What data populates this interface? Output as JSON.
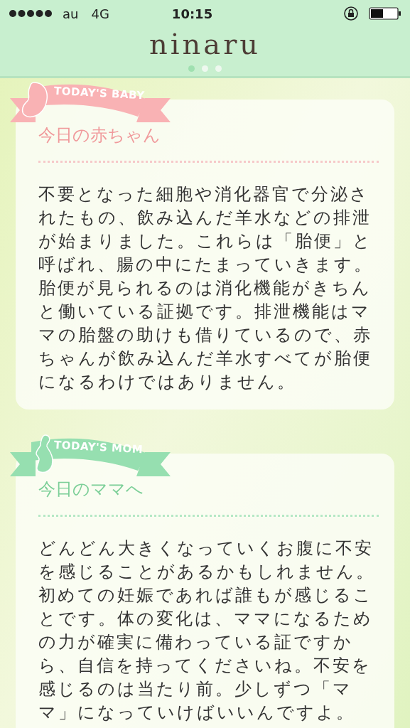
{
  "status_bar": {
    "carrier": "au",
    "network": "4G",
    "time": "10:15"
  },
  "header": {
    "logo": "ninaru",
    "pages": [
      {
        "selected": true
      },
      {
        "selected": false
      },
      {
        "selected": false
      }
    ]
  },
  "cards": [
    {
      "kind": "baby",
      "ribbon": "TODAY'S BABY",
      "title": "今日の赤ちゃん",
      "body_lines": [
        "不要となった細胞や消化器官で分泌さ",
        "れたもの、飲み込んだ羊水などの排泄",
        "が始まりました。これらは「胎便」と",
        "呼ばれ、腸の中にたまっていきます。",
        "胎便が見られるのは消化機能がきちん",
        "と働いている証拠です。排泄機能はマ",
        "マの胎盤の助けも借りているので、赤",
        "ちゃんが飲み込んだ羊水すべてが胎便",
        "になるわけではありません。"
      ]
    },
    {
      "kind": "mom",
      "ribbon": "TODAY'S MOM",
      "title": "今日のママへ",
      "body_lines": [
        "どんどん大きくなっていくお腹に不安",
        "を感じることがあるかもしれません。",
        "初めての妊娠であれば誰もが感じるこ",
        "とです。体の変化は、ママになるため",
        "の力が確実に備わっている証ですか",
        "ら、自信を持ってくださいね。不安を",
        "感じるのは当たり前。少しずつ「マ",
        "マ」になっていけばいいんですよ。"
      ]
    }
  ]
}
